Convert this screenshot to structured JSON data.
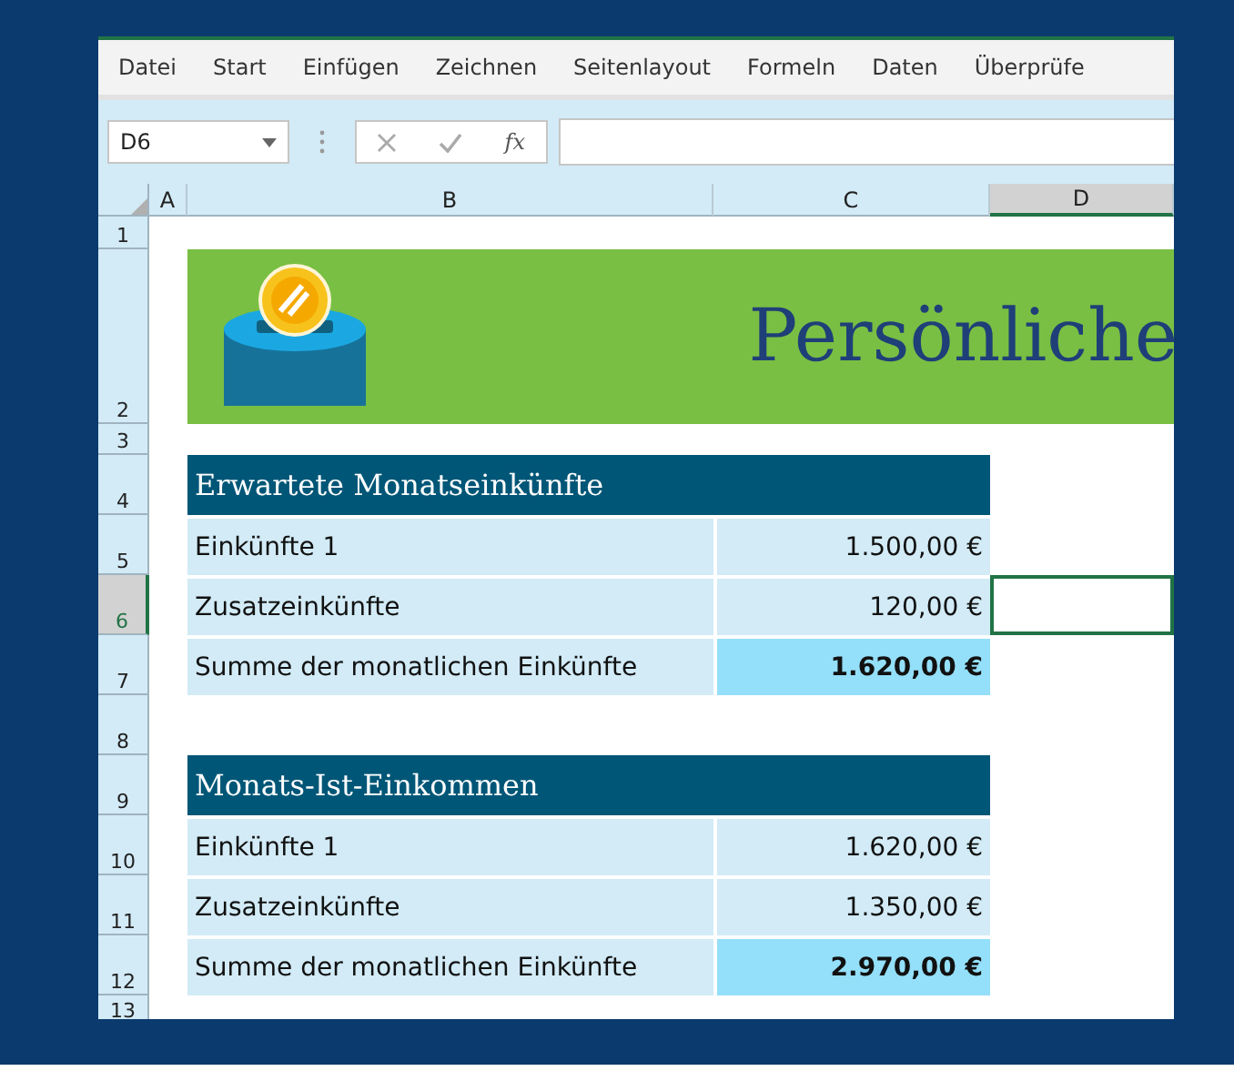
{
  "menu": [
    "Datei",
    "Start",
    "Einfügen",
    "Zeichnen",
    "Seitenlayout",
    "Formeln",
    "Daten",
    "Überprüfe"
  ],
  "formula_bar": {
    "name_box": "D6",
    "fx": "fx"
  },
  "columns": [
    {
      "label": "A",
      "selected": false
    },
    {
      "label": "B",
      "selected": false
    },
    {
      "label": "C",
      "selected": false
    },
    {
      "label": "D",
      "selected": true
    }
  ],
  "rows": [
    {
      "label": "1",
      "selected": false
    },
    {
      "label": "2",
      "selected": false
    },
    {
      "label": "3",
      "selected": false
    },
    {
      "label": "4",
      "selected": false
    },
    {
      "label": "5",
      "selected": false
    },
    {
      "label": "6",
      "selected": true
    },
    {
      "label": "7",
      "selected": false
    },
    {
      "label": "8",
      "selected": false
    },
    {
      "label": "9",
      "selected": false
    },
    {
      "label": "10",
      "selected": false
    },
    {
      "label": "11",
      "selected": false
    },
    {
      "label": "12",
      "selected": false
    },
    {
      "label": "13",
      "selected": false
    }
  ],
  "banner": {
    "title": "Persönliche"
  },
  "tables": [
    {
      "title": "Erwartete Monatseinkünfte",
      "rows": [
        {
          "kind": "item",
          "label": "Einkünfte 1",
          "value": "1.500,00 €"
        },
        {
          "kind": "item",
          "label": "Zusatzeinkünfte",
          "value": "120,00 €"
        },
        {
          "kind": "total",
          "label": "Summe der monatlichen Einkünfte",
          "value": "1.620,00 €"
        }
      ]
    },
    {
      "title": "Monats-Ist-Einkommen",
      "rows": [
        {
          "kind": "item",
          "label": "Einkünfte 1",
          "value": "1.620,00 €"
        },
        {
          "kind": "item",
          "label": "Zusatzeinkünfte",
          "value": "1.350,00 €"
        },
        {
          "kind": "total",
          "label": "Summe der monatlichen Einkünfte",
          "value": "2.970,00 €"
        }
      ]
    }
  ]
}
